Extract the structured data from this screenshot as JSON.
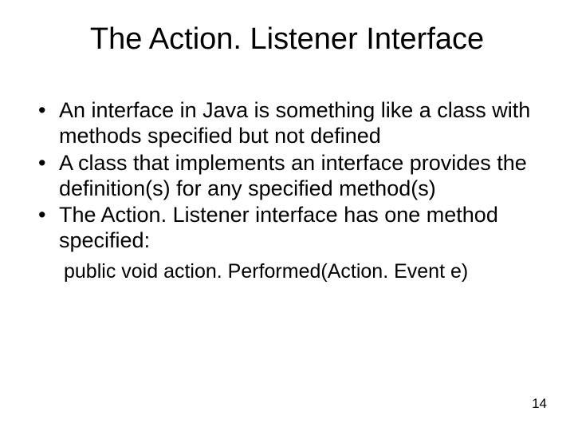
{
  "title": "The Action. Listener Interface",
  "bullets": [
    "An interface in Java is something like a class with methods specified but not defined",
    "A class that implements an interface provides the definition(s) for any specified method(s)",
    "The Action. Listener interface has one method specified:"
  ],
  "codeline": "public void action. Performed(Action. Event e)",
  "pagenum": "14"
}
